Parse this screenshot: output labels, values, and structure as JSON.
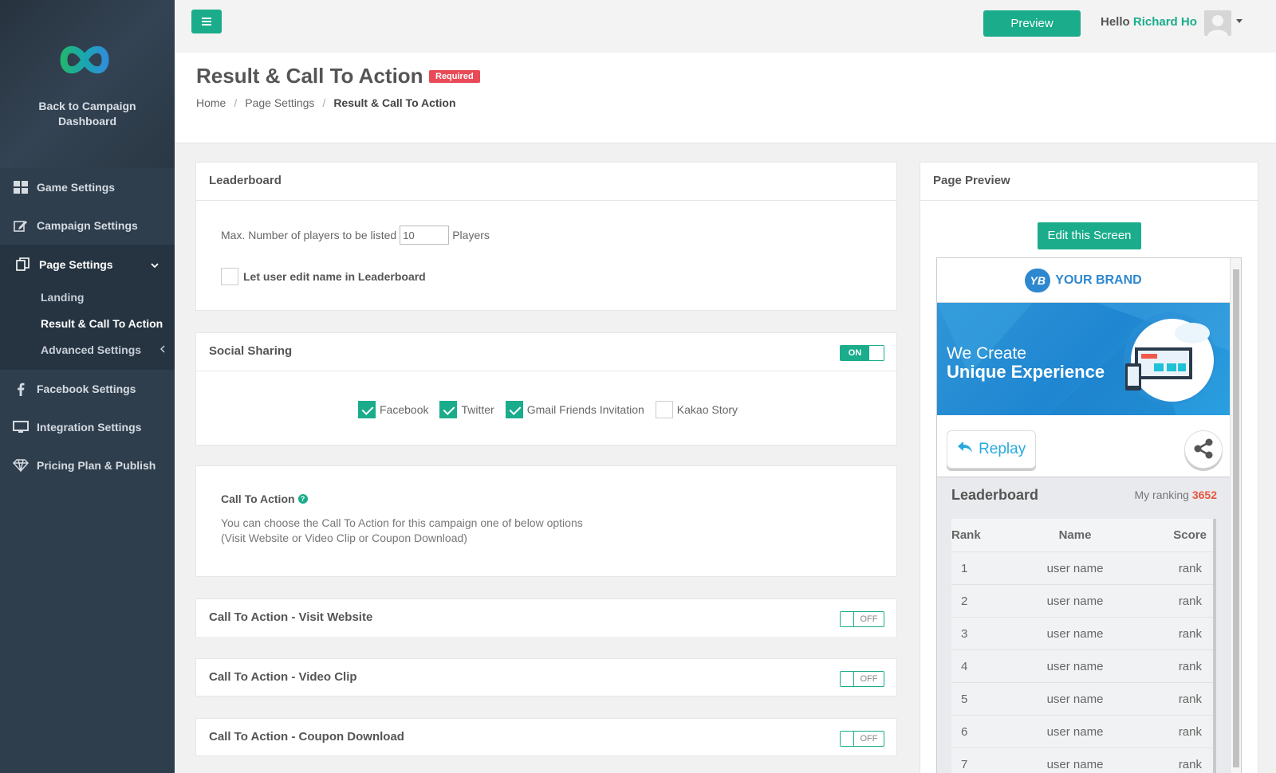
{
  "sidebar": {
    "back_label_1": "Back to Campaign",
    "back_label_2": "Dashboard",
    "items": [
      {
        "label": "Game Settings",
        "icon": "grid-icon"
      },
      {
        "label": "Campaign Settings",
        "icon": "edit-icon"
      },
      {
        "label": "Page Settings",
        "icon": "copy-icon"
      },
      {
        "label": "Facebook Settings",
        "icon": "facebook-icon"
      },
      {
        "label": "Integration Settings",
        "icon": "monitor-icon"
      },
      {
        "label": "Pricing Plan & Publish",
        "icon": "diamond-icon"
      }
    ],
    "submenu": [
      {
        "label": "Landing"
      },
      {
        "label": "Result & Call To Action"
      },
      {
        "label": "Advanced Settings"
      }
    ]
  },
  "topbar": {
    "preview_label": "Preview",
    "hello": "Hello",
    "user_name": "Richard Ho"
  },
  "header": {
    "title": "Result & Call To Action",
    "badge": "Required",
    "breadcrumb": [
      "Home",
      "Page Settings",
      "Result & Call To Action"
    ],
    "breadcrumb_sep": "/"
  },
  "leaderboard_panel": {
    "title": "Leaderboard",
    "max_label": "Max. Number of players to be listed",
    "max_value": "10",
    "players_label": "Players",
    "edit_name_label": "Let user edit name in Leaderboard"
  },
  "social_panel": {
    "title": "Social Sharing",
    "toggle": "ON",
    "options": [
      {
        "label": "Facebook",
        "checked": true
      },
      {
        "label": "Twitter",
        "checked": true
      },
      {
        "label": "Gmail Friends Invitation",
        "checked": true
      },
      {
        "label": "Kakao Story",
        "checked": false
      }
    ]
  },
  "cta_panel": {
    "title": "Call To Action",
    "desc_1": "You can choose the Call To Action for this campaign one of below options",
    "desc_2": "(Visit Website or Video Clip or Coupon Download)"
  },
  "cta_sections": [
    {
      "title": "Call To Action - Visit Website",
      "toggle": "OFF"
    },
    {
      "title": "Call To Action - Video Clip",
      "toggle": "OFF"
    },
    {
      "title": "Call To Action - Coupon Download",
      "toggle": "OFF"
    }
  ],
  "preview_panel": {
    "title": "Page Preview",
    "edit_label": "Edit this Screen",
    "brand": "YOUR BRAND",
    "brand_mark": "YB",
    "banner_line1": "We Create",
    "banner_line2": "Unique Experience",
    "replay_label": "Replay",
    "lb_title": "Leaderboard",
    "my_ranking_label": "My ranking",
    "my_ranking_value": "3652",
    "columns": [
      "Rank",
      "Name",
      "Score"
    ],
    "rows": [
      {
        "rank": "1",
        "name": "user name",
        "score": "rank"
      },
      {
        "rank": "2",
        "name": "user name",
        "score": "rank"
      },
      {
        "rank": "3",
        "name": "user name",
        "score": "rank"
      },
      {
        "rank": "4",
        "name": "user name",
        "score": "rank"
      },
      {
        "rank": "5",
        "name": "user name",
        "score": "rank"
      },
      {
        "rank": "6",
        "name": "user name",
        "score": "rank"
      },
      {
        "rank": "7",
        "name": "user name",
        "score": "rank"
      }
    ]
  },
  "colors": {
    "accent": "#1aac8b",
    "sidebar": "#2f3e4d",
    "badge": "#e84b57",
    "banner": "#1f86d1"
  }
}
